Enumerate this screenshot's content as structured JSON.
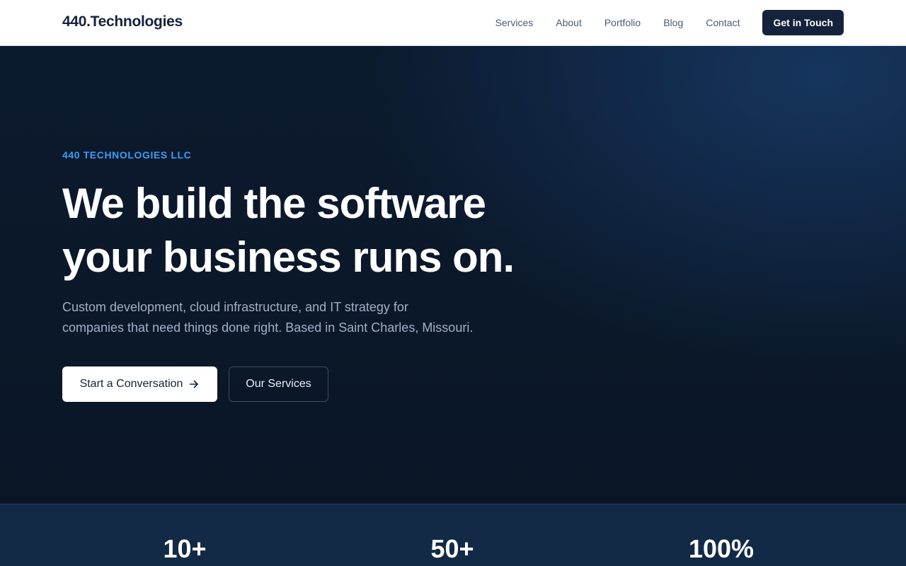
{
  "nav": {
    "brand": "440.Technologies",
    "links": [
      "Services",
      "About",
      "Portfolio",
      "Blog",
      "Contact"
    ],
    "cta": "Get in Touch"
  },
  "hero": {
    "eyebrow": "440 TECHNOLOGIES LLC",
    "headline_line1": "We build the software",
    "headline_line2": "your business runs on.",
    "subtext_line1": "Custom development, cloud infrastructure, and IT strategy for",
    "subtext_line2": "companies that need things done right. Based in Saint Charles, Missouri.",
    "primary_button": "Start a Conversation",
    "primary_button_icon": "arrow-right-icon",
    "secondary_button": "Our Services"
  },
  "stats": {
    "items": [
      "10+",
      "50+",
      "100%"
    ]
  },
  "colors": {
    "brand_dark": "#14233b",
    "accent_blue": "#3b9cf5",
    "hero_bg": "#0b1628",
    "stats_bg": "#132a47"
  }
}
